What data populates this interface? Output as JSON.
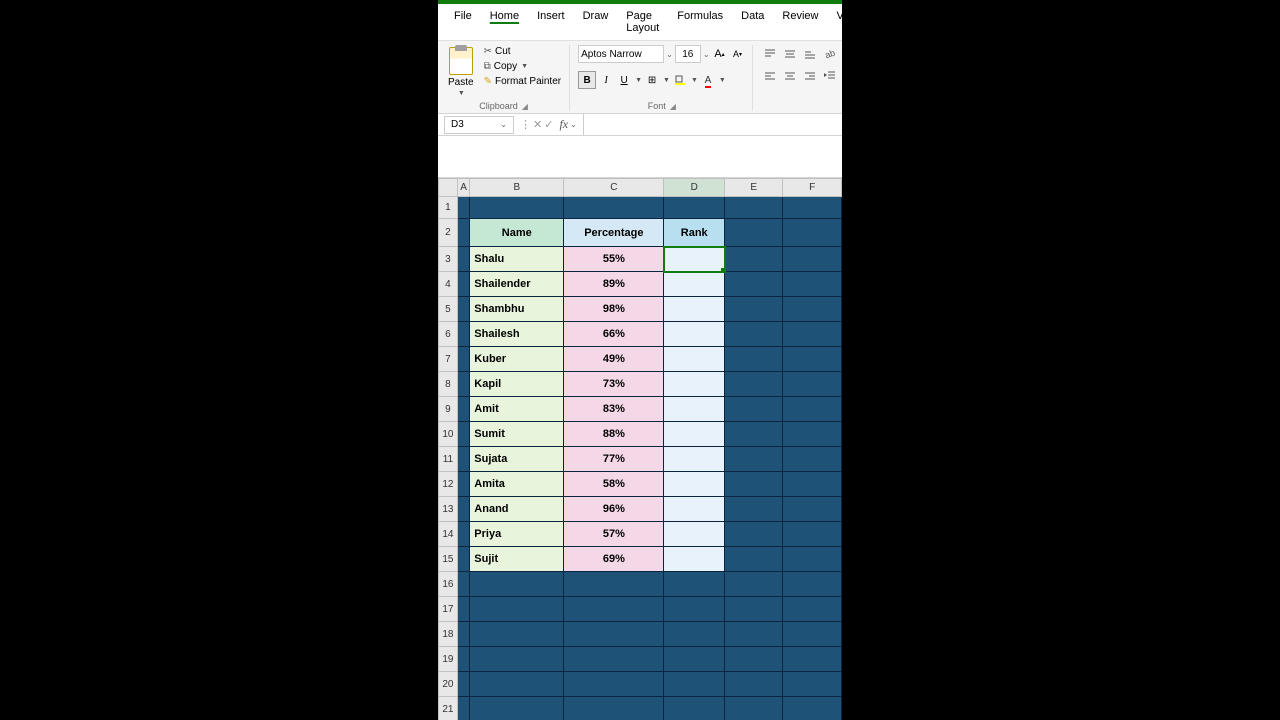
{
  "menu": {
    "file": "File",
    "home": "Home",
    "insert": "Insert",
    "draw": "Draw",
    "page_layout": "Page Layout",
    "formulas": "Formulas",
    "data": "Data",
    "review": "Review",
    "view": "Vie"
  },
  "ribbon": {
    "paste": "Paste",
    "cut": "Cut",
    "copy": "Copy",
    "format_painter": "Format Painter",
    "clipboard_label": "Clipboard",
    "font_name": "Aptos Narrow",
    "font_size": "16",
    "font_label": "Font",
    "bold": "B",
    "italic": "I",
    "underline": "U"
  },
  "namebox": "D3",
  "formula": "",
  "columns": [
    "A",
    "B",
    "C",
    "D",
    "E",
    "F"
  ],
  "headers": {
    "name": "Name",
    "percentage": "Percentage",
    "rank": "Rank"
  },
  "rows": [
    {
      "n": 3,
      "name": "Shalu",
      "pct": "55%"
    },
    {
      "n": 4,
      "name": "Shailender",
      "pct": "89%"
    },
    {
      "n": 5,
      "name": "Shambhu",
      "pct": "98%"
    },
    {
      "n": 6,
      "name": "Shailesh",
      "pct": "66%"
    },
    {
      "n": 7,
      "name": "Kuber",
      "pct": "49%"
    },
    {
      "n": 8,
      "name": "Kapil",
      "pct": "73%"
    },
    {
      "n": 9,
      "name": "Amit",
      "pct": "83%"
    },
    {
      "n": 10,
      "name": "Sumit",
      "pct": "88%"
    },
    {
      "n": 11,
      "name": "Sujata",
      "pct": "77%"
    },
    {
      "n": 12,
      "name": "Amita",
      "pct": "58%"
    },
    {
      "n": 13,
      "name": "Anand",
      "pct": "96%"
    },
    {
      "n": 14,
      "name": "Priya",
      "pct": "57%"
    },
    {
      "n": 15,
      "name": "Sujit",
      "pct": "69%"
    }
  ],
  "empty_rows": [
    16,
    17,
    18,
    19,
    20,
    21
  ]
}
